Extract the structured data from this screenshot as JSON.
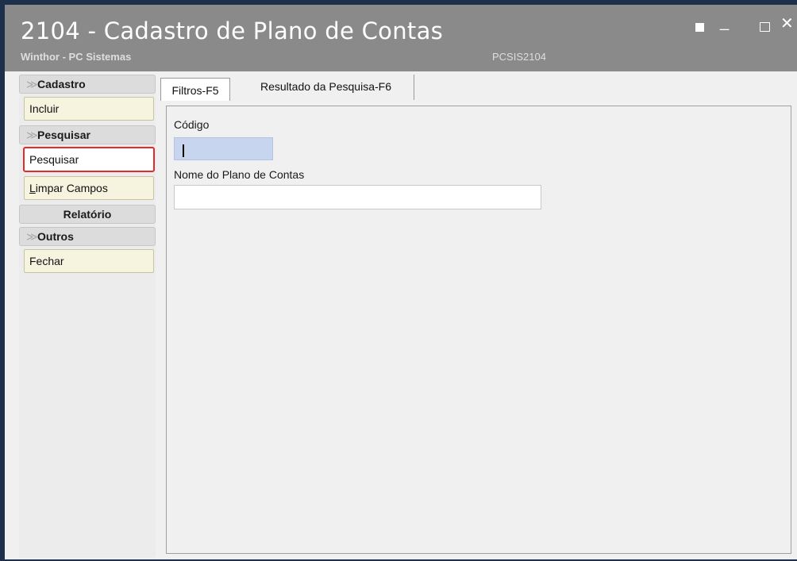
{
  "window": {
    "title": "2104 - Cadastro de Plano de Contas",
    "subtitle": "Winthor - PC Sistemas",
    "routine_code": "PCSIS2104",
    "controls": {
      "restore_icon": "restore-icon",
      "minimize": "_",
      "maximize_icon": "maximize-icon",
      "close": "✕"
    }
  },
  "sidebar": {
    "cadastro": {
      "title": "Cadastro",
      "items": [
        {
          "label": "Incluir"
        }
      ]
    },
    "pesquisar": {
      "title": "Pesquisar",
      "items": [
        {
          "label": "Pesquisar"
        },
        {
          "label_mnemonic": "L",
          "label_rest": "impar Campos"
        }
      ]
    },
    "relatorio": {
      "title": "Relatório"
    },
    "outros": {
      "title": "Outros",
      "items": [
        {
          "label": "Fechar"
        }
      ]
    }
  },
  "tabs": [
    {
      "label": "Filtros-F5"
    },
    {
      "label": "Resultado da Pesquisa-F6"
    }
  ],
  "filters": {
    "codigo": {
      "label": "Código",
      "value": ""
    },
    "nome": {
      "label": "Nome do Plano de Contas",
      "value": ""
    }
  },
  "colors": {
    "highlight": "#e22b2b",
    "title_bar": "#8a8a8a",
    "focused_field": "#c7d5ef"
  }
}
